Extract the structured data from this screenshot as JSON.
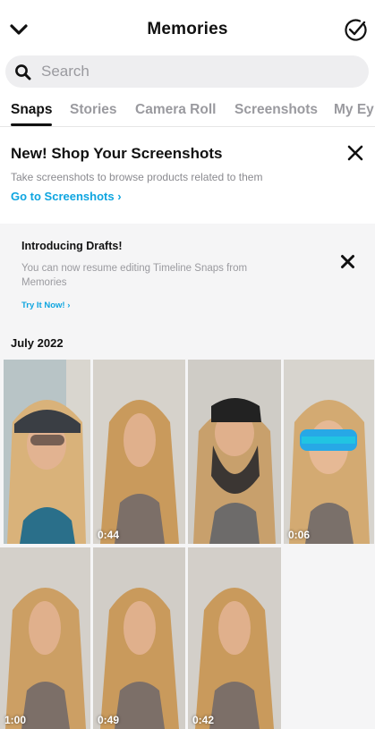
{
  "header": {
    "title": "Memories"
  },
  "search": {
    "placeholder": "Search"
  },
  "tabs": [
    {
      "label": "Snaps",
      "active": true
    },
    {
      "label": "Stories",
      "active": false
    },
    {
      "label": "Camera Roll",
      "active": false
    },
    {
      "label": "Screenshots",
      "active": false
    },
    {
      "label": "My Ey",
      "active": false
    }
  ],
  "shop_banner": {
    "title": "New! Shop Your Screenshots",
    "subtitle": "Take screenshots to browse products related to them",
    "link": "Go to Screenshots ›"
  },
  "drafts_banner": {
    "title": "Introducing Drafts!",
    "subtitle": "You can now resume editing Timeline Snaps from Memories",
    "link": "Try It Now! ›"
  },
  "section": {
    "date": "July 2022"
  },
  "snaps": [
    {
      "duration": "",
      "filter": "cap-sunglasses"
    },
    {
      "duration": "0:44",
      "filter": "distorted-face"
    },
    {
      "duration": "",
      "filter": "beard-cap"
    },
    {
      "duration": "0:06",
      "filter": "blue-goggles"
    },
    {
      "duration": "1:00",
      "filter": "distorted-face"
    },
    {
      "duration": "0:49",
      "filter": "distorted-face"
    },
    {
      "duration": "0:42",
      "filter": "distorted-face"
    }
  ],
  "colors": {
    "accent": "#0ea5e0",
    "inactive_tab": "#9a9a9f"
  }
}
